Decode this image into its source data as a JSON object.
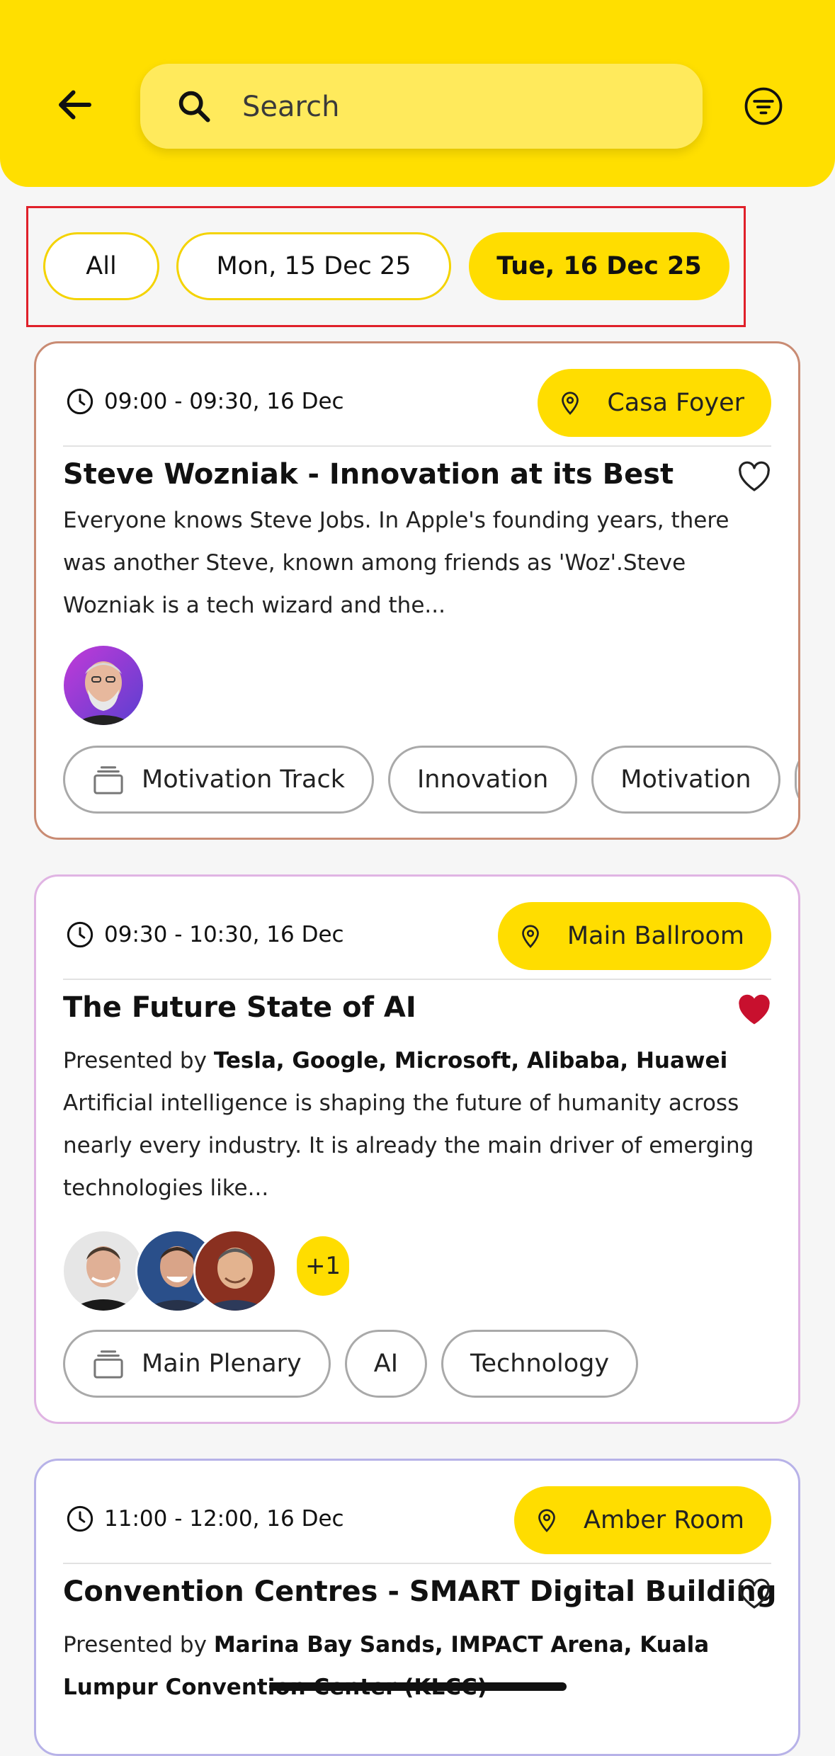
{
  "header": {
    "search_placeholder": "Search"
  },
  "date_tabs": [
    {
      "label": "All",
      "active": false
    },
    {
      "label": "Mon, 15 Dec 25",
      "active": false
    },
    {
      "label": "Tue, 16 Dec 25",
      "active": true
    }
  ],
  "sessions": [
    {
      "time": "09:00 - 09:30, 16 Dec",
      "location": "Casa Foyer",
      "title": "Steve Wozniak - Innovation at its Best",
      "favorite": false,
      "description": "Everyone knows Steve Jobs. In Apple's founding years, there was another Steve, known among friends as 'Woz'.Steve Wozniak is a tech wizard and the...",
      "speakers": 1,
      "tags": [
        "Motivation Track",
        "Innovation",
        "Motivation"
      ]
    },
    {
      "time": "09:30 - 10:30, 16 Dec",
      "location": "Main Ballroom",
      "title": "The Future State of AI",
      "favorite": true,
      "presented_by_label": "Presented by",
      "presented_by": "Tesla, Google, Microsoft, Alibaba, Huawei",
      "description": "Artificial intelligence is shaping the future of humanity across nearly every industry. It is already the main driver of emerging technologies like...",
      "speakers": 3,
      "more_speakers": "+1",
      "tags": [
        "Main Plenary",
        "AI",
        "Technology"
      ]
    },
    {
      "time": "11:00 - 12:00, 16 Dec",
      "location": "Amber Room",
      "title": "Convention Centres - SMART Digital Building",
      "favorite": false,
      "presented_by_label": "Presented by",
      "presented_by": "Marina Bay Sands, IMPACT Arena, Kuala Lumpur Convention Center (KLCC)"
    }
  ],
  "colors": {
    "accent": "#ffdf00",
    "favorite_active": "#c8102e",
    "highlight_border": "#e0202a"
  },
  "icons": [
    "back-arrow-icon",
    "search-icon",
    "filter-icon",
    "clock-icon",
    "location-pin-icon",
    "heart-icon",
    "track-stack-icon"
  ]
}
